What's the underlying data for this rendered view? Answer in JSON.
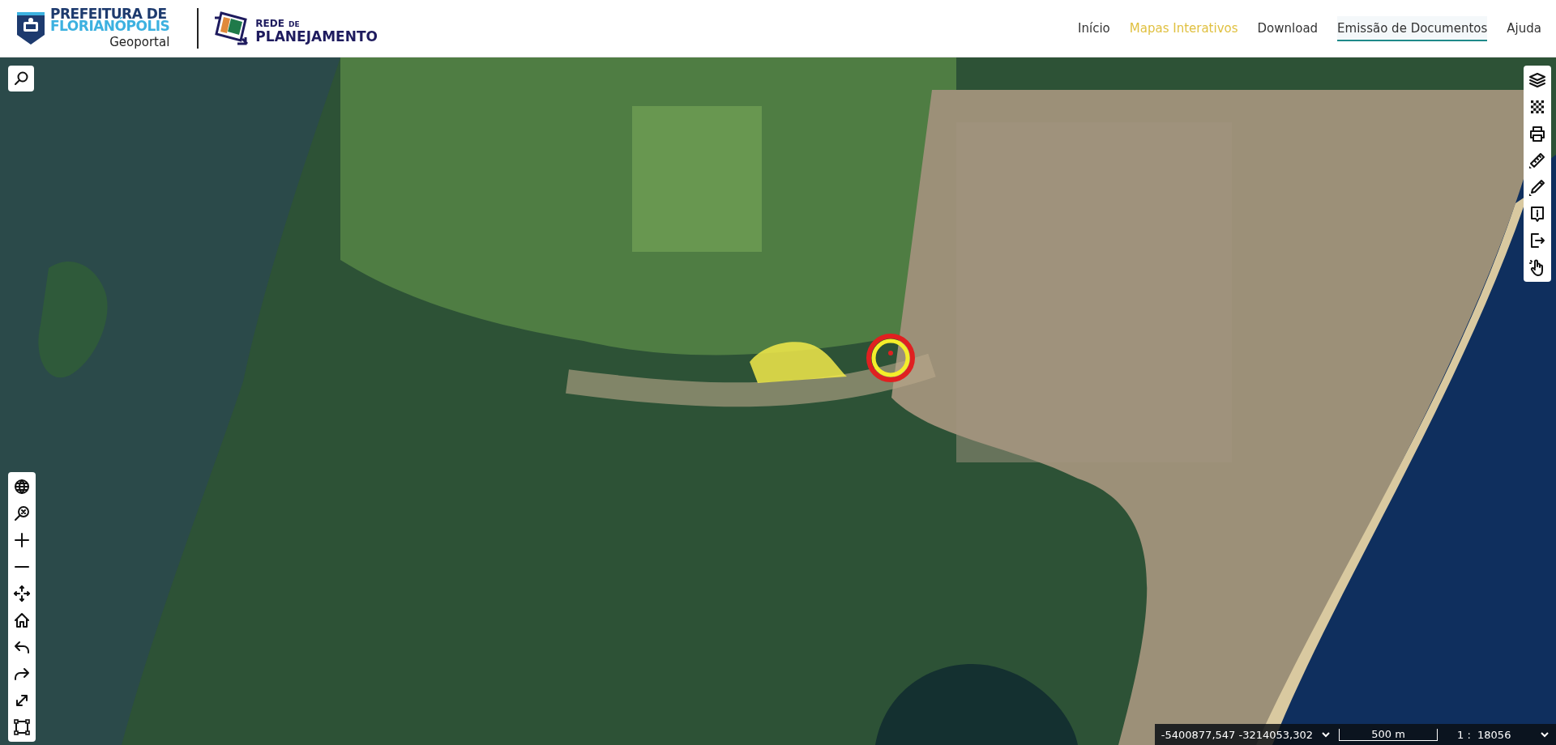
{
  "header": {
    "logo_line_1": "PREFEITURA DE",
    "logo_line_2": "FLORIANÓPOLIS",
    "logo_subtitle": "Geoportal",
    "partner_line_1": "REDE",
    "partner_line_1_small": "DE",
    "partner_line_2": "PLANEJAMENTO"
  },
  "nav": [
    {
      "label": "Início",
      "selected": false,
      "highlighted": false
    },
    {
      "label": "Mapas Interativos",
      "selected": false,
      "highlighted": true
    },
    {
      "label": "Download",
      "selected": false,
      "highlighted": false
    },
    {
      "label": "Emissão de Documentos",
      "selected": true,
      "highlighted": false
    },
    {
      "label": "Ajuda",
      "selected": false,
      "highlighted": false
    }
  ],
  "map": {
    "search_tool": {
      "kind": "search"
    },
    "right_tools": [
      {
        "kind": "layers"
      },
      {
        "kind": "grid"
      },
      {
        "kind": "print"
      },
      {
        "kind": "ruler"
      },
      {
        "kind": "pencil"
      },
      {
        "kind": "info"
      },
      {
        "kind": "export"
      },
      {
        "kind": "hand"
      }
    ],
    "left_tools": [
      {
        "kind": "globe"
      },
      {
        "kind": "zoom-extent"
      },
      {
        "kind": "zoom-in"
      },
      {
        "kind": "zoom-out"
      },
      {
        "kind": "pan"
      },
      {
        "kind": "home"
      },
      {
        "kind": "undo"
      },
      {
        "kind": "redo"
      },
      {
        "kind": "fullscreen"
      },
      {
        "kind": "select"
      }
    ]
  },
  "status_bar": {
    "coordinates": "-5400877,547 -3214053,302",
    "scale_bar": "500 m",
    "scale_ratio": "1 :  18056"
  }
}
